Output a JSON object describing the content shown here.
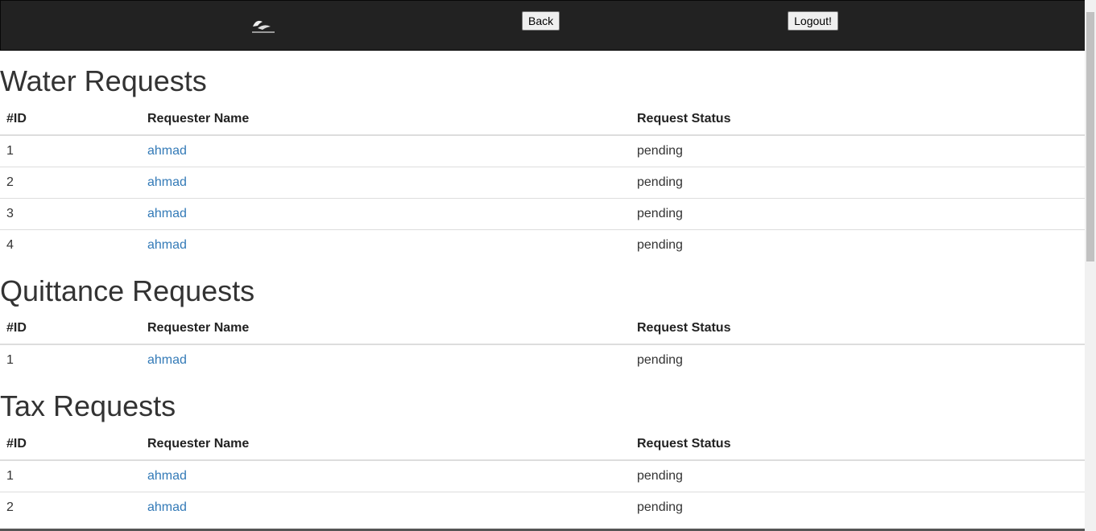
{
  "nav": {
    "back_label": "Back",
    "logout_label": "Logout!"
  },
  "columns": {
    "id": "#ID",
    "name": "Requester Name",
    "status": "Request Status"
  },
  "sections": [
    {
      "title": "Water Requests",
      "rows": [
        {
          "id": "1",
          "name": "ahmad",
          "status": "pending"
        },
        {
          "id": "2",
          "name": "ahmad",
          "status": "pending"
        },
        {
          "id": "3",
          "name": "ahmad",
          "status": "pending"
        },
        {
          "id": "4",
          "name": "ahmad",
          "status": "pending"
        }
      ]
    },
    {
      "title": "Quittance Requests",
      "rows": [
        {
          "id": "1",
          "name": "ahmad",
          "status": "pending"
        }
      ]
    },
    {
      "title": "Tax Requests",
      "rows": [
        {
          "id": "1",
          "name": "ahmad",
          "status": "pending"
        },
        {
          "id": "2",
          "name": "ahmad",
          "status": "pending"
        }
      ]
    }
  ]
}
